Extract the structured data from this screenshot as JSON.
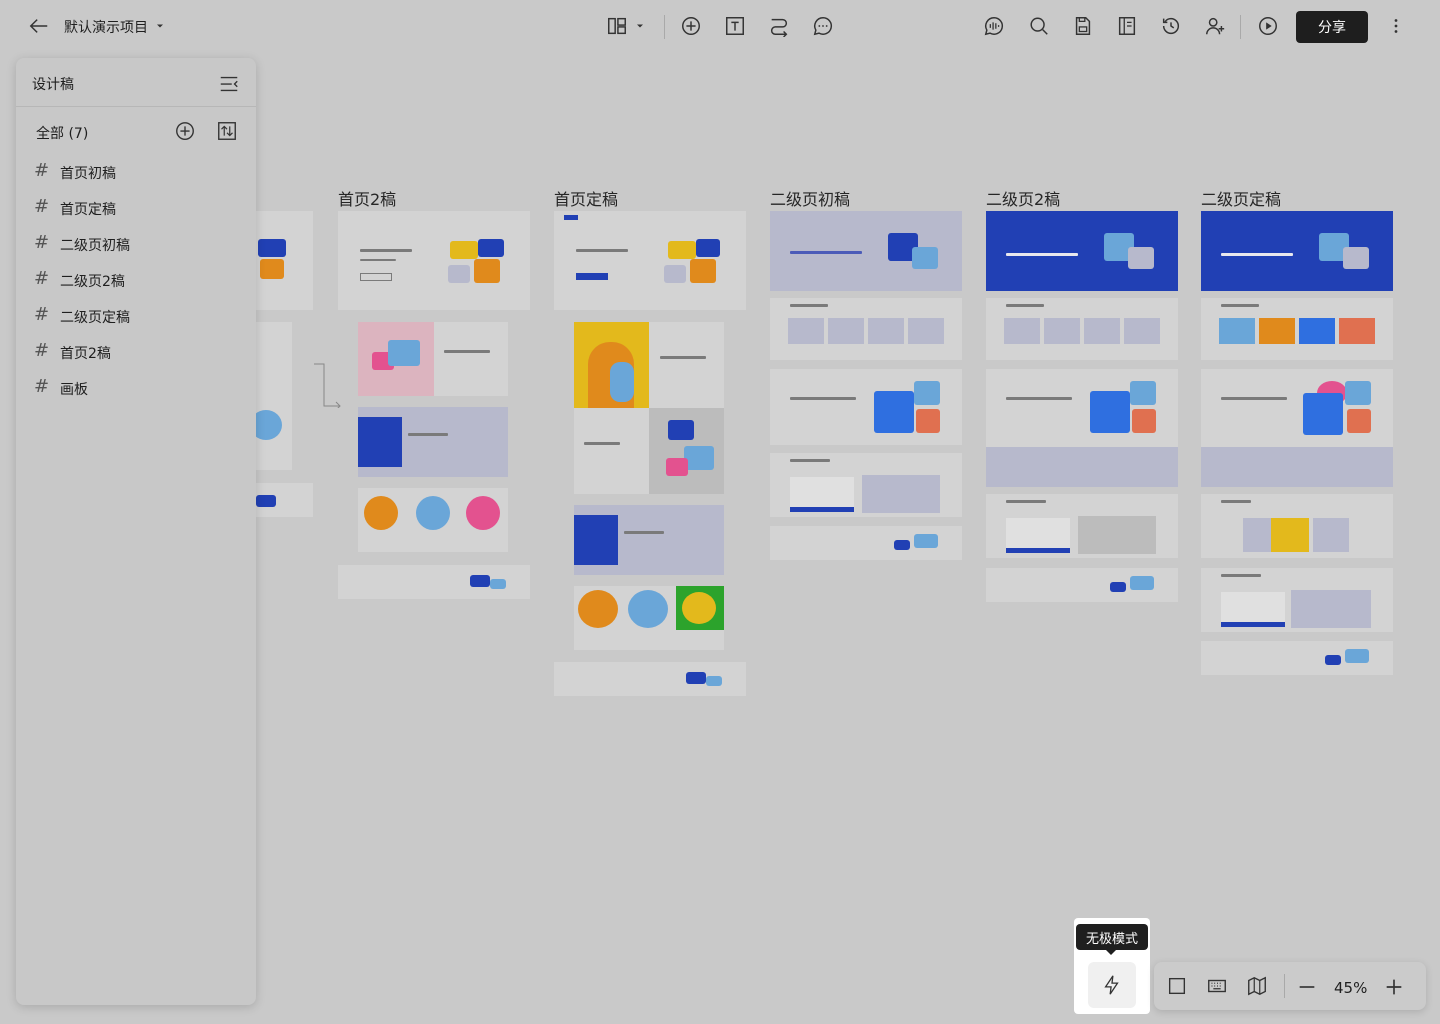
{
  "header": {
    "project_title": "默认演示项目",
    "share_label": "分享",
    "icons": [
      "back-arrow-icon",
      "dropdown-caret-icon",
      "layout-icon",
      "add-circle-icon",
      "text-box-icon",
      "connector-icon",
      "comment-icon",
      "voice-icon",
      "search-icon",
      "save-icon",
      "book-icon",
      "history-icon",
      "add-user-icon",
      "play-icon",
      "more-vertical-icon"
    ]
  },
  "sidebar": {
    "title": "设计稿",
    "all_label": "全部 (7)",
    "items": [
      {
        "label": "首页初稿"
      },
      {
        "label": "首页定稿"
      },
      {
        "label": "二级页初稿"
      },
      {
        "label": "二级页2稿"
      },
      {
        "label": "二级页定稿"
      },
      {
        "label": "首页2稿"
      },
      {
        "label": "画板"
      }
    ]
  },
  "canvas": {
    "columns": [
      {
        "title": "首页2稿"
      },
      {
        "title": "首页定稿"
      },
      {
        "title": "二级页初稿"
      },
      {
        "title": "二级页2稿"
      },
      {
        "title": "二级页定稿"
      }
    ],
    "colors": {
      "blue": "#2140b4",
      "orange": "#e08a1c",
      "yellow": "#e3b91c",
      "light_blue": "#6aa6d8",
      "pink": "#e3528f",
      "green": "#2ca32c"
    }
  },
  "bottom": {
    "tooltip": "无极模式",
    "zoom_level": "45%",
    "icons": [
      "infinite-mode-icon",
      "frame-icon",
      "keyboard-icon",
      "map-icon",
      "zoom-out-icon",
      "zoom-in-icon"
    ]
  }
}
